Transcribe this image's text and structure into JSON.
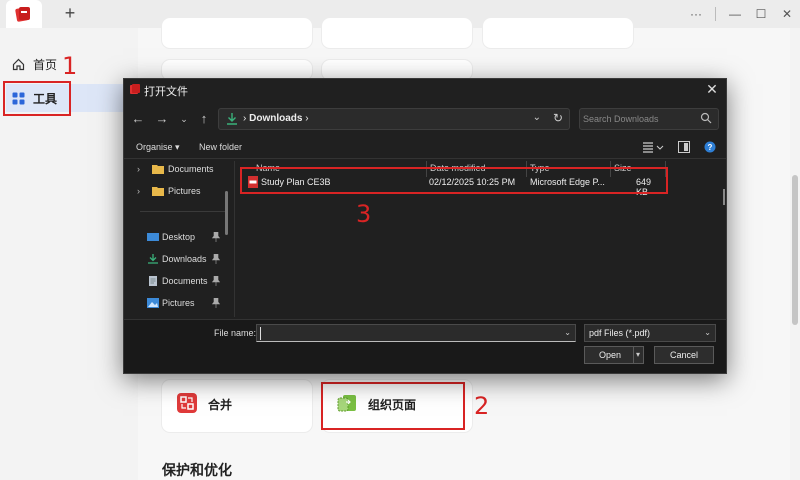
{
  "titlebar": {
    "window_icons": [
      "more-icon",
      "minimize-icon",
      "maximize-icon",
      "close-icon"
    ]
  },
  "sidebar": {
    "items": [
      {
        "label": "首页",
        "icon": "home-icon"
      },
      {
        "label": "工具",
        "icon": "tools-grid-icon",
        "active": true
      }
    ]
  },
  "annotations": [
    "1",
    "2",
    "3"
  ],
  "main": {
    "cards": [
      {
        "label": "合并",
        "icon": "merge-icon"
      },
      {
        "label": "组织页面",
        "icon": "organize-pages-icon"
      }
    ],
    "section_title": "保护和优化"
  },
  "dialog": {
    "title": "打开文件",
    "address": {
      "path": "Downloads"
    },
    "search": {
      "placeholder": "Search Downloads"
    },
    "commands": {
      "organise": "Organise",
      "new_folder": "New folder"
    },
    "nav_pane": [
      {
        "label": "Documents",
        "icon": "folder-icon",
        "expandable": true
      },
      {
        "label": "Pictures",
        "icon": "folder-icon",
        "expandable": true
      },
      {
        "label": "Desktop",
        "icon": "desktop-icon",
        "pinned": true
      },
      {
        "label": "Downloads",
        "icon": "download-icon",
        "pinned": true
      },
      {
        "label": "Documents",
        "icon": "document-icon",
        "pinned": true
      },
      {
        "label": "Pictures",
        "icon": "pictures-icon",
        "pinned": true
      }
    ],
    "columns": [
      "Name",
      "Date modified",
      "Type",
      "Size"
    ],
    "files": [
      {
        "name": "Study Plan CE3B",
        "date": "02/12/2025 10:25 PM",
        "type": "Microsoft Edge P...",
        "size": "649 KB"
      }
    ],
    "footer": {
      "file_name_label": "File name:",
      "file_name_value": "",
      "file_type": "pdf Files (*.pdf)",
      "open_label": "Open",
      "cancel_label": "Cancel"
    }
  },
  "colors": {
    "accent": "#d92424",
    "selected_bg": "#dde6f7",
    "dialog_bg": "#202020"
  }
}
